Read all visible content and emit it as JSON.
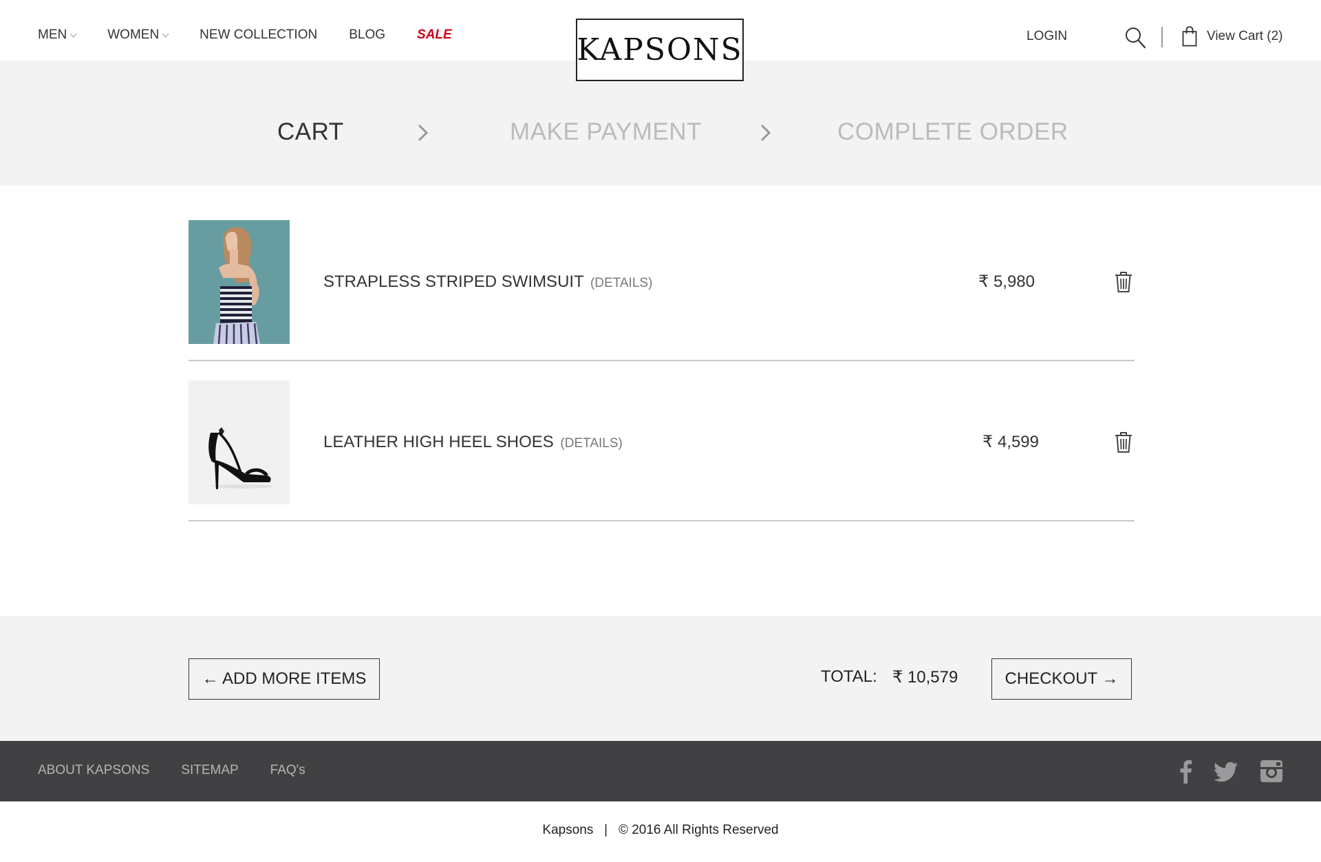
{
  "header": {
    "nav": [
      {
        "label": "MEN",
        "has_dropdown": true
      },
      {
        "label": "WOMEN",
        "has_dropdown": true
      },
      {
        "label": "NEW COLLECTION",
        "has_dropdown": false
      },
      {
        "label": "BLOG",
        "has_dropdown": false
      },
      {
        "label": "SALE",
        "has_dropdown": false,
        "color": "#d0021b"
      }
    ],
    "logo": "KAPSONS",
    "login": "LOGIN",
    "cart_label": "View Cart (2)"
  },
  "steps": [
    {
      "label": "CART",
      "active": true
    },
    {
      "label": "MAKE PAYMENT",
      "active": false
    },
    {
      "label": "COMPLETE ORDER",
      "active": false
    }
  ],
  "items": [
    {
      "title": "STRAPLESS STRIPED SWIMSUIT",
      "details": "(DETAILS)",
      "price": "₹ 5,980",
      "image": "woman in striped swimsuit"
    },
    {
      "title": "LEATHER HIGH HEEL SHOES",
      "details": "(DETAILS)",
      "price": "₹ 4,599",
      "image": "black high heel sandal"
    }
  ],
  "summary": {
    "add_more": "← ADD MORE ITEMS",
    "total_label": "TOTAL:",
    "total_value": "₹ 10,579",
    "checkout": "CHECKOUT →"
  },
  "footer": {
    "links": [
      "ABOUT KAPSONS",
      "SITEMAP",
      "FAQ's"
    ],
    "social": [
      "facebook-icon",
      "twitter-icon",
      "instagram-icon"
    ],
    "copyright": "Kapsons   |   © 2016 All Rights Reserved"
  },
  "colors": {
    "accent_sale": "#d0021b",
    "panel": "#f3f3f3",
    "footer": "#414143"
  }
}
